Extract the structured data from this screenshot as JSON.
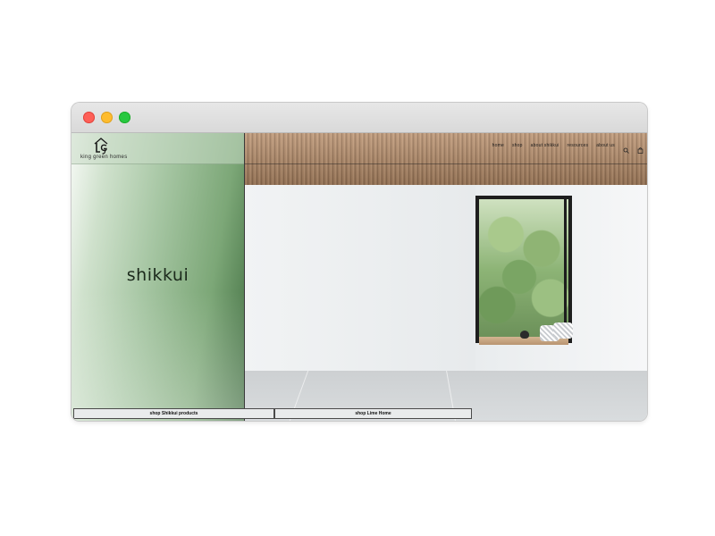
{
  "window": {
    "title": "",
    "controls": [
      "close",
      "minimize",
      "zoom"
    ]
  },
  "brand": {
    "name": "king green homes",
    "logo_icon": "lg-house-monogram-icon"
  },
  "nav": {
    "links": [
      "home",
      "shop",
      "about shikkui",
      "resources",
      "about us"
    ],
    "search_icon": "search-icon",
    "cart_icon": "cart-icon"
  },
  "hero": {
    "word": "shikkui"
  },
  "cta": {
    "primary": "shop Shikkui products",
    "secondary": "shop Lime Home"
  },
  "colors": {
    "accent_green": "#3f6c3f",
    "close": "#fe5f57",
    "minimize": "#febc2e",
    "zoom": "#28c840"
  }
}
